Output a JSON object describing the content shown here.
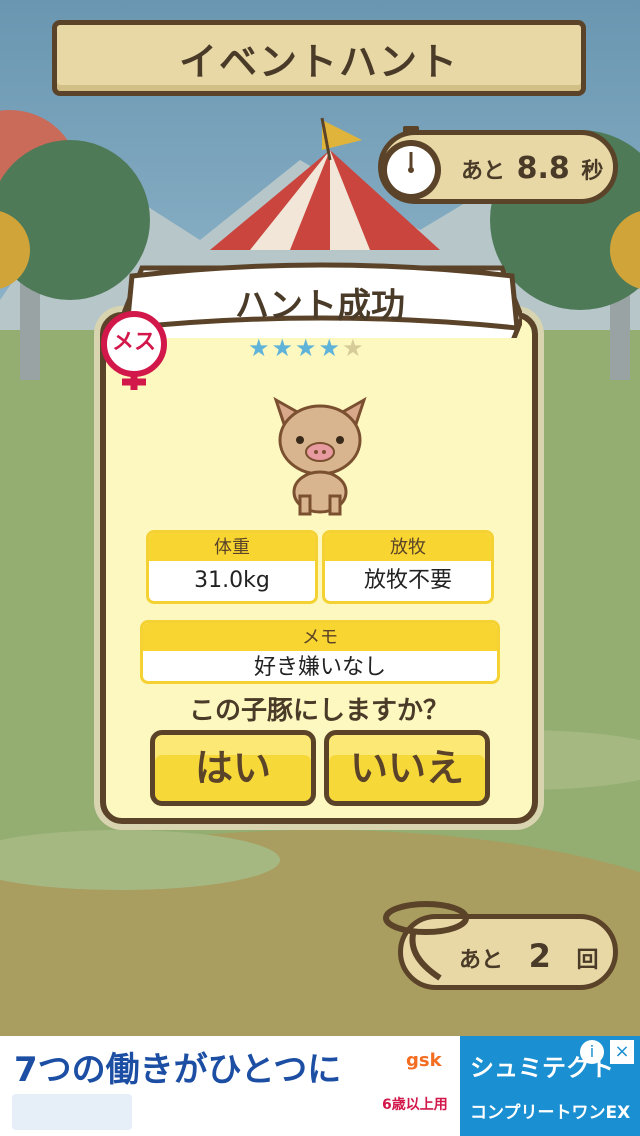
{
  "header": {
    "title": "イベントハント"
  },
  "timer": {
    "prefix": "あと",
    "value": "8.8",
    "unit": "秒"
  },
  "dialog": {
    "title": "ハント成功",
    "gender_badge": "メス",
    "stars": {
      "filled": 4,
      "total": 5
    },
    "weight": {
      "label": "体重",
      "value": "31.0kg"
    },
    "grazing": {
      "label": "放牧",
      "value": "放牧不要"
    },
    "memo": {
      "label": "メモ",
      "value": "好き嫌いなし"
    },
    "question": "この子豚にしますか？",
    "yes_label": "はい",
    "no_label": "いいえ"
  },
  "remaining": {
    "prefix": "あと",
    "value": "2",
    "unit": "回"
  },
  "ad": {
    "headline": "7つの働きがひとつに",
    "brand": "シュミテクト",
    "product": "コンプリートワンEX",
    "age_note": "6歳以上用",
    "sponsor": "gsk"
  },
  "colors": {
    "accent": "#f6d939",
    "outline": "#5a4328",
    "panel": "#fdf7c0",
    "star_filled": "#5fb3d8",
    "star_empty": "#d6cc99"
  }
}
